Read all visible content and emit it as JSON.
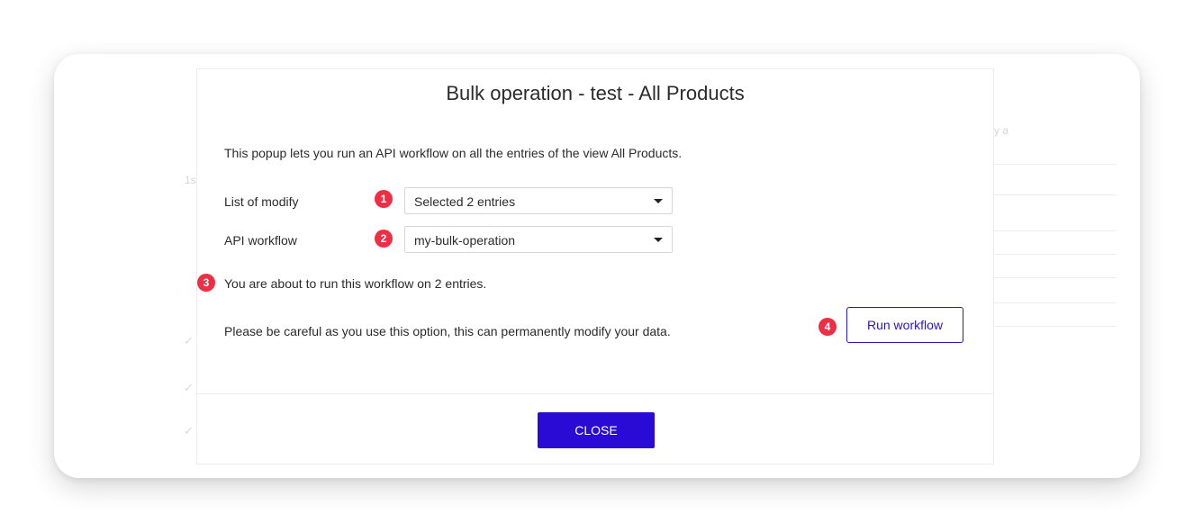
{
  "popup": {
    "title": "Bulk operation - test - All Products",
    "intro": "This popup lets you run an API workflow on all the entries of the view All Products.",
    "list_label": "List of modify",
    "list_value": "Selected 2 entries",
    "workflow_label": "API workflow",
    "workflow_value": "my-bulk-operation",
    "notice": "You are about to run this workflow on 2 entries.",
    "warning": "Please be careful as you use this option, this can permanently modify your data.",
    "run_label": "Run workflow",
    "close_label": "CLOSE"
  },
  "badges": [
    "1",
    "2",
    "3",
    "4"
  ],
  "background": {
    "text_a": "y a",
    "text_b": "1s",
    "check_mark": "✓"
  },
  "colors": {
    "accent": "#2a0bd6",
    "badge": "#ee2e45"
  }
}
